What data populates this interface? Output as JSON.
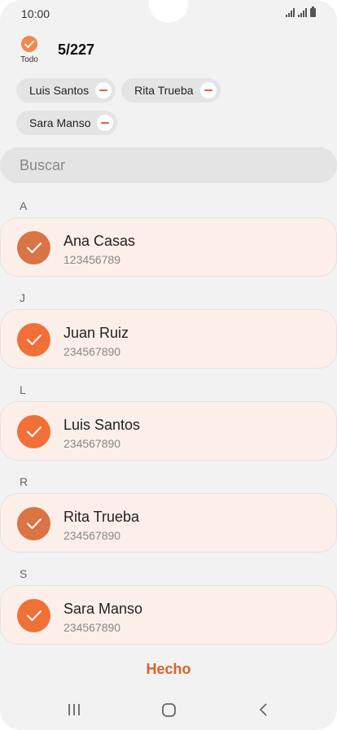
{
  "status_bar": {
    "time": "10:00"
  },
  "header": {
    "select_all_label": "Todo",
    "count": "5/227"
  },
  "selected_chips": [
    {
      "label": "Luis Santos"
    },
    {
      "label": "Rita Trueba"
    },
    {
      "label": "Sara Manso"
    }
  ],
  "search": {
    "placeholder": "Buscar",
    "value": ""
  },
  "sections": [
    {
      "letter": "A",
      "contact": {
        "name": "Ana Casas",
        "phone": "123456789",
        "checked": true
      }
    },
    {
      "letter": "J",
      "contact": {
        "name": "Juan Ruiz",
        "phone": "234567890",
        "checked": true
      }
    },
    {
      "letter": "L",
      "contact": {
        "name": "Luis Santos",
        "phone": "234567890",
        "checked": true
      }
    },
    {
      "letter": "R",
      "contact": {
        "name": "Rita Trueba",
        "phone": "234567890",
        "checked": true
      }
    },
    {
      "letter": "S",
      "contact": {
        "name": "Sara Manso",
        "phone": "234567890",
        "checked": true
      }
    }
  ],
  "done_label": "Hecho",
  "colors": {
    "accent": "#f07038",
    "accent_muted": "#d97444",
    "done_text": "#d9622a",
    "card_bg": "#fcefe9",
    "chip_remove": "#e06040"
  },
  "icons": {
    "check": "check-icon",
    "remove": "minus-icon",
    "recents": "recents-icon",
    "home": "home-icon",
    "back": "back-icon"
  }
}
